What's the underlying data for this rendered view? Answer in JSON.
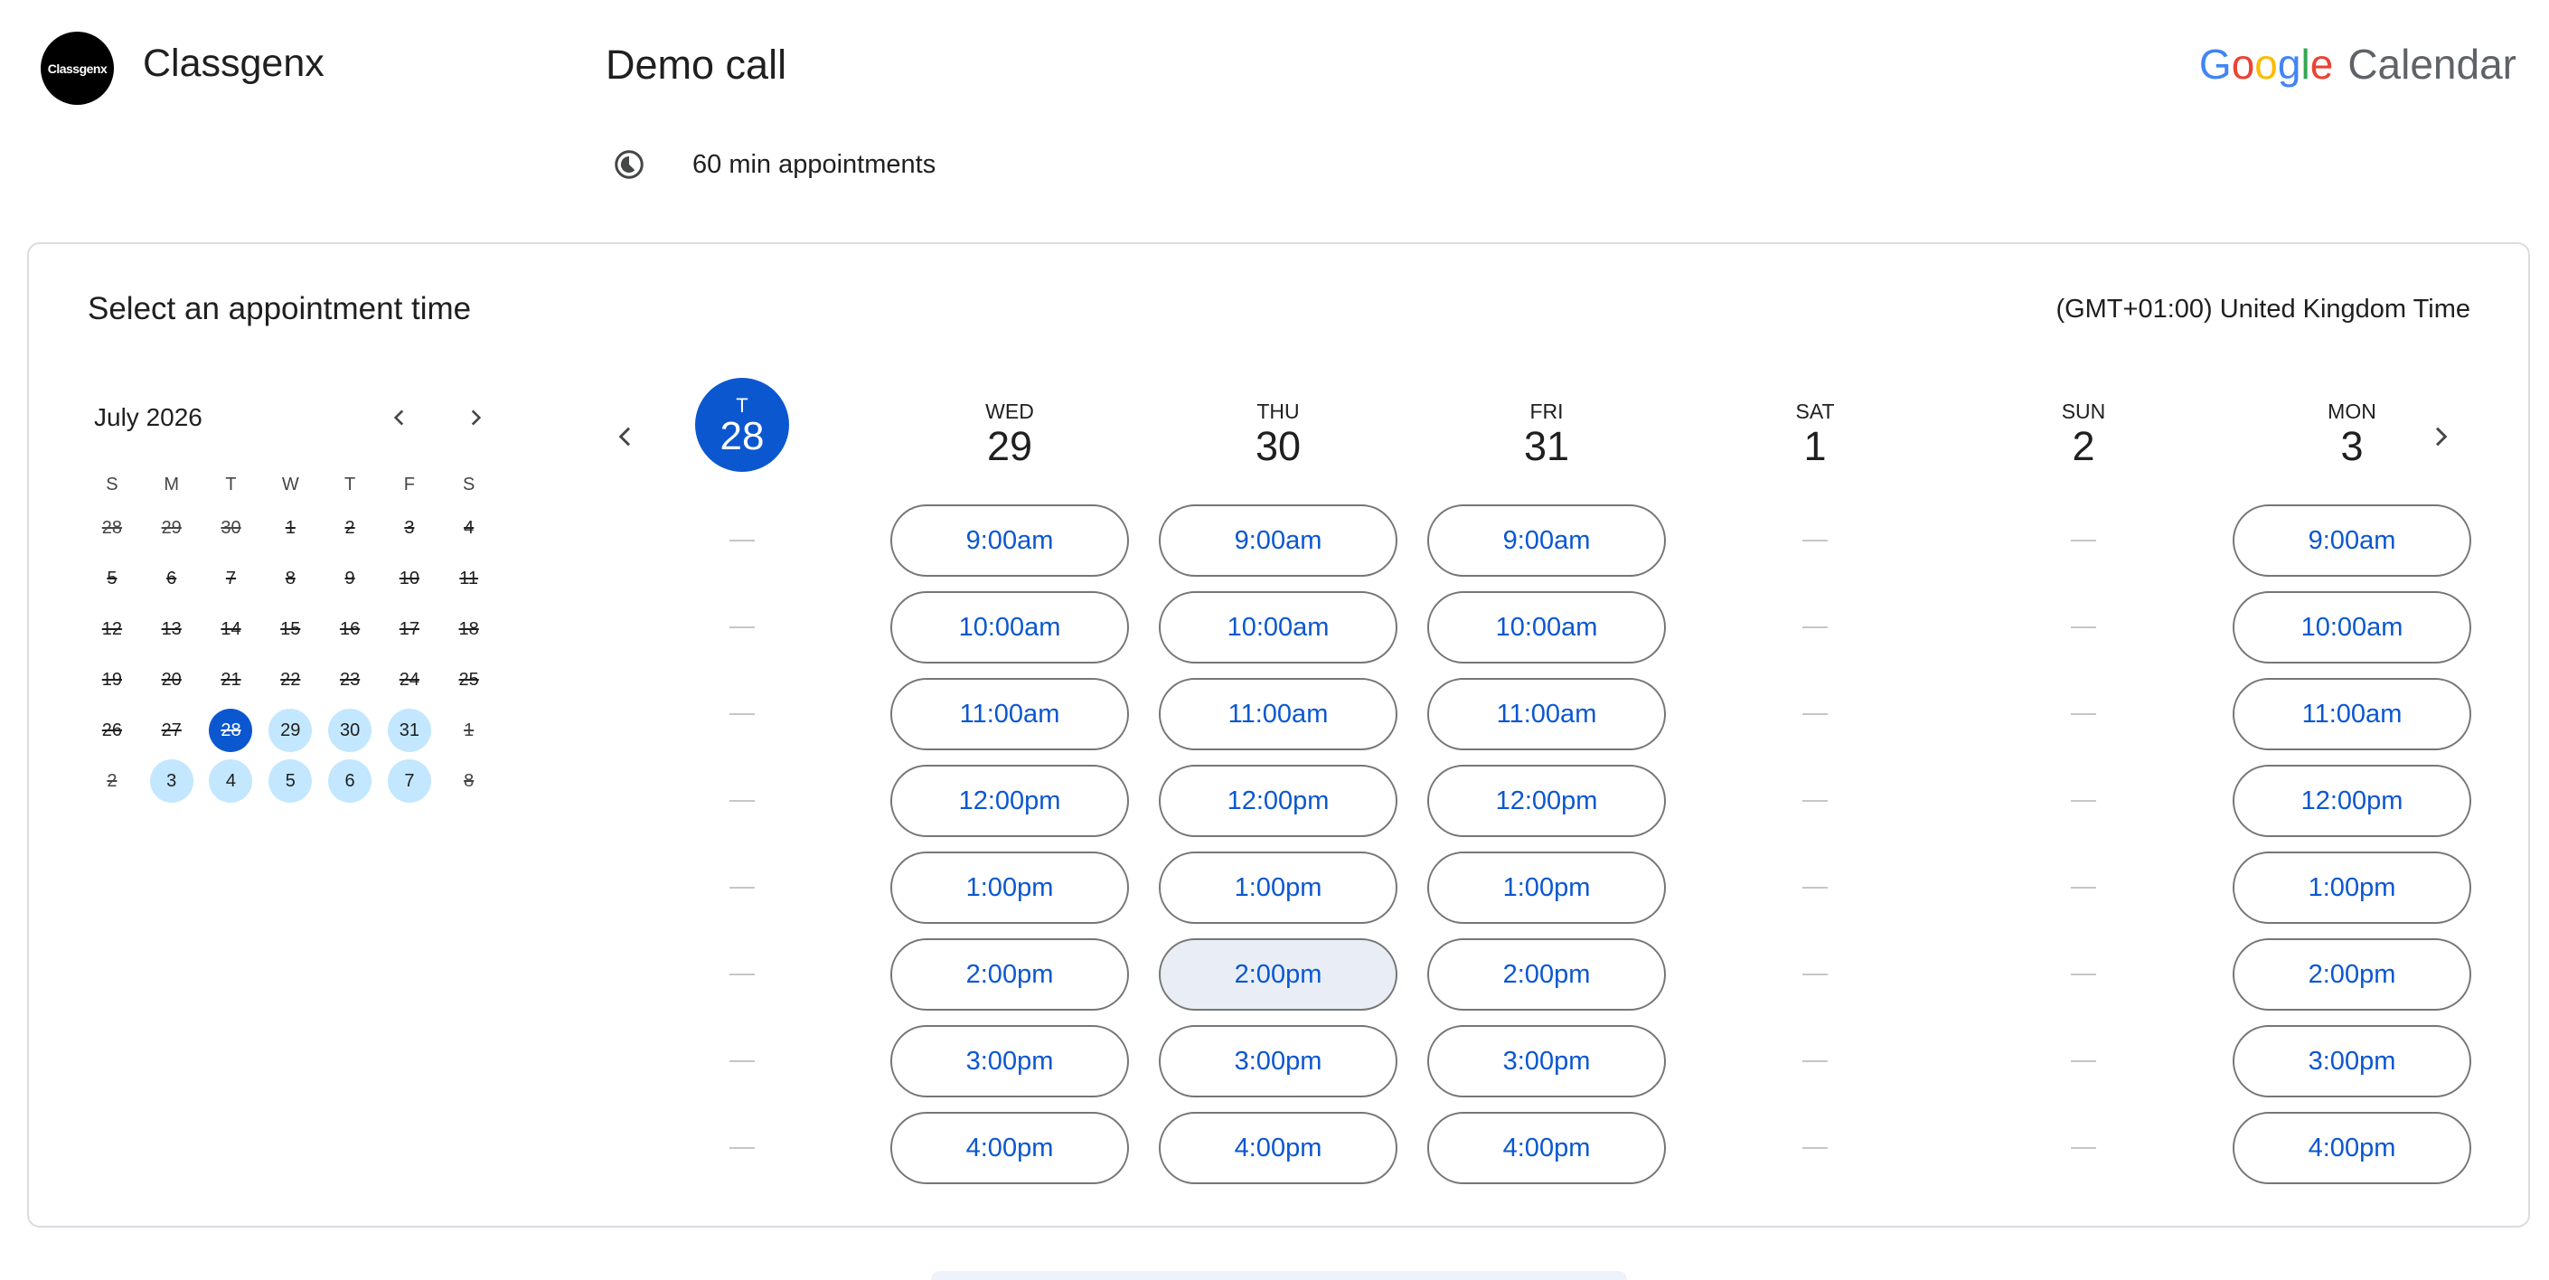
{
  "header": {
    "logo_text": "Classgenx",
    "brand": "Classgenx",
    "title": "Demo call",
    "google_word": [
      "G",
      "o",
      "o",
      "g",
      "l",
      "e"
    ],
    "google_colors": [
      "#4285F4",
      "#EA4335",
      "#FBBC05",
      "#4285F4",
      "#34A853",
      "#EA4335"
    ],
    "calendar_word": "Calendar",
    "duration": "60 min appointments",
    "duration_icon": "timer-icon"
  },
  "card": {
    "title": "Select an appointment time",
    "timezone": "(GMT+01:00) United Kingdom Time"
  },
  "mini_calendar": {
    "month": "July 2026",
    "prev_icon": "chevron-left-icon",
    "next_icon": "chevron-right-icon",
    "dow": [
      "S",
      "M",
      "T",
      "W",
      "T",
      "F",
      "S"
    ],
    "weeks": [
      [
        {
          "d": "28",
          "s": "other"
        },
        {
          "d": "29",
          "s": "other"
        },
        {
          "d": "30",
          "s": "other"
        },
        {
          "d": "1",
          "s": "past"
        },
        {
          "d": "2",
          "s": "past"
        },
        {
          "d": "3",
          "s": "past"
        },
        {
          "d": "4",
          "s": "past"
        }
      ],
      [
        {
          "d": "5",
          "s": "past"
        },
        {
          "d": "6",
          "s": "past"
        },
        {
          "d": "7",
          "s": "past"
        },
        {
          "d": "8",
          "s": "past"
        },
        {
          "d": "9",
          "s": "past"
        },
        {
          "d": "10",
          "s": "past"
        },
        {
          "d": "11",
          "s": "past"
        }
      ],
      [
        {
          "d": "12",
          "s": "past"
        },
        {
          "d": "13",
          "s": "past"
        },
        {
          "d": "14",
          "s": "past"
        },
        {
          "d": "15",
          "s": "past"
        },
        {
          "d": "16",
          "s": "past"
        },
        {
          "d": "17",
          "s": "past"
        },
        {
          "d": "18",
          "s": "past"
        }
      ],
      [
        {
          "d": "19",
          "s": "past"
        },
        {
          "d": "20",
          "s": "past"
        },
        {
          "d": "21",
          "s": "past"
        },
        {
          "d": "22",
          "s": "past"
        },
        {
          "d": "23",
          "s": "past"
        },
        {
          "d": "24",
          "s": "past"
        },
        {
          "d": "25",
          "s": "past"
        }
      ],
      [
        {
          "d": "26",
          "s": "past"
        },
        {
          "d": "27",
          "s": "past"
        },
        {
          "d": "28",
          "s": "sel"
        },
        {
          "d": "29",
          "s": "avail"
        },
        {
          "d": "30",
          "s": "avail"
        },
        {
          "d": "31",
          "s": "avail"
        },
        {
          "d": "1",
          "s": "other"
        }
      ],
      [
        {
          "d": "2",
          "s": "other"
        },
        {
          "d": "3",
          "s": "avail"
        },
        {
          "d": "4",
          "s": "avail"
        },
        {
          "d": "5",
          "s": "avail"
        },
        {
          "d": "6",
          "s": "avail"
        },
        {
          "d": "7",
          "s": "avail"
        },
        {
          "d": "8",
          "s": "other"
        }
      ]
    ]
  },
  "week": {
    "prev_icon": "chevron-left-icon",
    "next_icon": "chevron-right-icon",
    "days": [
      {
        "dow": "T",
        "num": "28",
        "today": true,
        "slots": []
      },
      {
        "dow": "WED",
        "num": "29",
        "today": false,
        "slots": [
          "9:00am",
          "10:00am",
          "11:00am",
          "12:00pm",
          "1:00pm",
          "2:00pm",
          "3:00pm",
          "4:00pm"
        ]
      },
      {
        "dow": "THU",
        "num": "30",
        "today": false,
        "slots": [
          "9:00am",
          "10:00am",
          "11:00am",
          "12:00pm",
          "1:00pm",
          "2:00pm",
          "3:00pm",
          "4:00pm"
        ],
        "hover_index": 5
      },
      {
        "dow": "FRI",
        "num": "31",
        "today": false,
        "slots": [
          "9:00am",
          "10:00am",
          "11:00am",
          "12:00pm",
          "1:00pm",
          "2:00pm",
          "3:00pm",
          "4:00pm"
        ]
      },
      {
        "dow": "SAT",
        "num": "1",
        "today": false,
        "slots": []
      },
      {
        "dow": "SUN",
        "num": "2",
        "today": false,
        "slots": []
      },
      {
        "dow": "MON",
        "num": "3",
        "today": false,
        "slots": [
          "9:00am",
          "10:00am",
          "11:00am",
          "12:00pm",
          "1:00pm",
          "2:00pm",
          "3:00pm",
          "4:00pm"
        ]
      }
    ],
    "rows": 8
  },
  "colors": {
    "accent": "#0b57d0",
    "available": "#c2e7ff",
    "slot_hover": "#e9eef6"
  }
}
